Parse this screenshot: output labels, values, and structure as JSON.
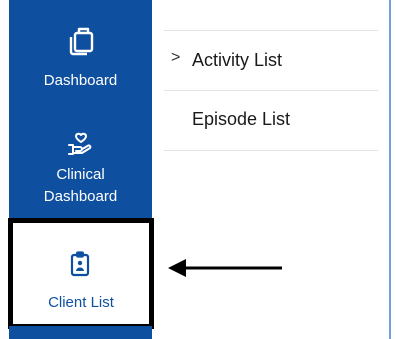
{
  "sidebar": {
    "items": [
      {
        "label": "Dashboard",
        "icon": "clipboard-stack-icon"
      },
      {
        "label_line1": "Clinical",
        "label_line2": "Dashboard",
        "icon": "hand-heart-icon"
      },
      {
        "label": "Client List",
        "icon": "client-badge-icon"
      }
    ]
  },
  "submenu": {
    "items": [
      {
        "label": "Activity List",
        "chevron": ">"
      },
      {
        "label": "Episode List"
      }
    ]
  },
  "colors": {
    "sidebar_blue": "#0f4f9f",
    "highlight_border": "#000000"
  }
}
